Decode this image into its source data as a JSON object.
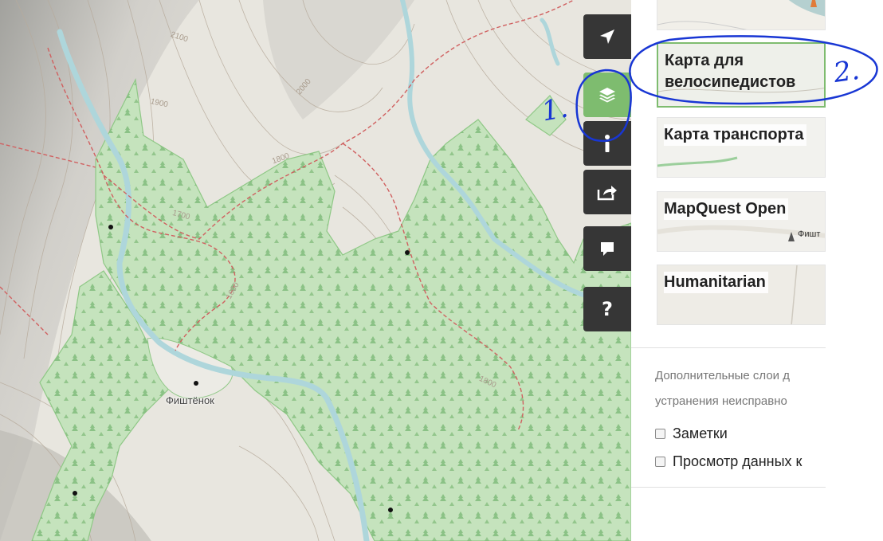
{
  "map": {
    "contour_labels": [
      "2100",
      "2000",
      "1900",
      "1800",
      "1700",
      "1600",
      "1800"
    ],
    "place_name": "Фиштёнок"
  },
  "toolbar": {
    "buttons": [
      {
        "icon": "navigation-arrow-icon"
      },
      {
        "icon": "layers-icon",
        "active": true
      },
      {
        "icon": "info-icon"
      },
      {
        "icon": "share-icon"
      },
      {
        "icon": "note-icon"
      },
      {
        "icon": "help-icon",
        "label": "?"
      }
    ],
    "active_color": "#7ebc6f",
    "button_color": "#363636"
  },
  "layers_panel": {
    "base_layers": [
      {
        "name": ""
      },
      {
        "name": "Карта для\nвелосипедистов",
        "selected": true
      },
      {
        "name": "Карта транспорта"
      },
      {
        "name": "MapQuest Open"
      },
      {
        "name": "Humanitarian"
      }
    ],
    "thumb_labels": {
      "mapquest_place": "Фишт"
    },
    "overlays_heading": "Дополнительные слои д устранения неисправно",
    "overlays": [
      {
        "label": "Заметки",
        "checked": false
      },
      {
        "label": "Просмотр данных к",
        "checked": false
      }
    ]
  },
  "annotations": {
    "mark_1": "1.",
    "mark_2": "2.",
    "color": "#1836d4"
  }
}
